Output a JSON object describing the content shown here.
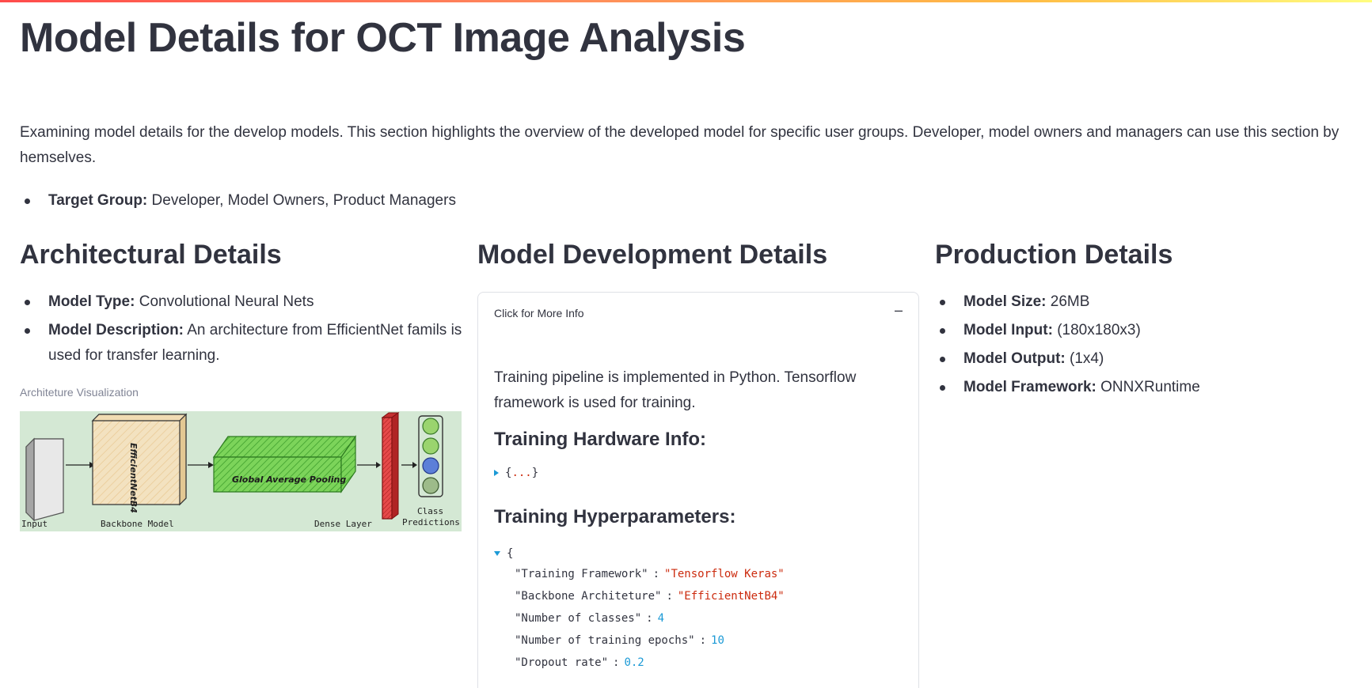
{
  "page": {
    "title": "Model Details for OCT Image Analysis",
    "intro": "Examining model details for the develop models. This section highlights the overview of the developed model for specific user groups. Developer, model owners and managers can use this section by hemselves.",
    "target_group": {
      "label": "Target Group:",
      "value": " Developer, Model Owners, Product Managers"
    }
  },
  "architectural": {
    "heading": "Architectural Details",
    "items": [
      {
        "label": "Model Type:",
        "value": " Convolutional Neural Nets"
      },
      {
        "label": "Model Description:",
        "value": " An architecture from EfficientNet famils is used for transfer learning."
      }
    ],
    "caption": "Architeture Visualization",
    "diagram": {
      "backbone_text": "EfficientNetB4",
      "pooling_text": "Global Average Pooling",
      "labels": [
        "Input",
        "Backbone Model",
        "Dense Layer",
        "Class",
        "Predictions"
      ]
    }
  },
  "development": {
    "heading": "Model Development Details",
    "expander_label": "Click for More Info",
    "expander_toggle": "–",
    "training_text": "Training pipeline is implemented in Python. Tensorflow framework is used for training.",
    "hardware_heading": "Training Hardware Info:",
    "hardware_collapsed": {
      "open": "{",
      "dots": "...",
      "close": "}"
    },
    "hyper_heading": "Training Hyperparameters:",
    "hyper_open": "{",
    "hyperparameters": [
      {
        "key": "\"Training Framework\"",
        "value": "\"Tensorflow Keras\"",
        "kind": "str"
      },
      {
        "key": "\"Backbone Architeture\"",
        "value": "\"EfficientNetB4\"",
        "kind": "str"
      },
      {
        "key": "\"Number of classes\"",
        "value": "4",
        "kind": "num"
      },
      {
        "key": "\"Number of training epochs\"",
        "value": "10",
        "kind": "num"
      },
      {
        "key": "\"Dropout rate\"",
        "value": "0.2",
        "kind": "num"
      }
    ]
  },
  "production": {
    "heading": "Production Details",
    "items": [
      {
        "label": "Model Size:",
        "value": " 26MB"
      },
      {
        "label": "Model Input:",
        "value": " (180x180x3)"
      },
      {
        "label": "Model Output:",
        "value": " (1x4)"
      },
      {
        "label": "Model Framework:",
        "value": " ONNXRuntime"
      }
    ]
  },
  "colors": {
    "accent_red": "#ff4b4b",
    "json_string": "#cc2b0e",
    "json_number": "#1c9ad6",
    "text": "#31333f"
  }
}
